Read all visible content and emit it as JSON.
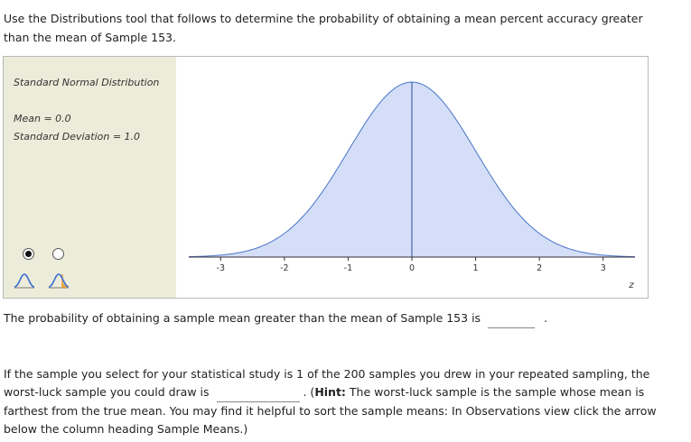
{
  "intro": {
    "text": "Use the Distributions tool that follows to determine the probability of obtaining a mean percent accuracy greater than the mean of Sample 153."
  },
  "tool": {
    "title": "Standard Normal Distribution",
    "mean_label": "Mean = 0.0",
    "sd_label": "Standard Deviation = 1.0",
    "mode_options": [
      {
        "icon": "normal-curve-icon",
        "selected": true
      },
      {
        "icon": "normal-curve-shaded-icon",
        "selected": false
      }
    ],
    "colors": {
      "panel_bg": "#ececda",
      "curve_fill": "#d4def7",
      "curve_stroke": "#4a74c9",
      "accent": "#e8a33a"
    },
    "chart_data": {
      "type": "area",
      "distribution": "normal",
      "mean": 0.0,
      "sd": 1.0,
      "xlim": [
        -3.5,
        3.5
      ],
      "tick_labels": [
        "-3",
        "-2",
        "-1",
        "0",
        "1",
        "2",
        "3"
      ],
      "xlabel": "z"
    }
  },
  "question2": {
    "prefix": "The probability of obtaining a sample mean greater than the mean of Sample 153 is",
    "suffix": "."
  },
  "question3": {
    "part1": "If the sample you select for your statistical study is 1 of the 200 samples you drew in your repeated sampling, the worst-luck sample you could draw is",
    "part2": ". (",
    "hint_label": "Hint:",
    "hint_text": " The worst-luck sample is the sample whose mean is farthest from the true mean. You may find it helpful to sort the sample means: In Observations view click the arrow below the column heading Sample Means.)"
  }
}
